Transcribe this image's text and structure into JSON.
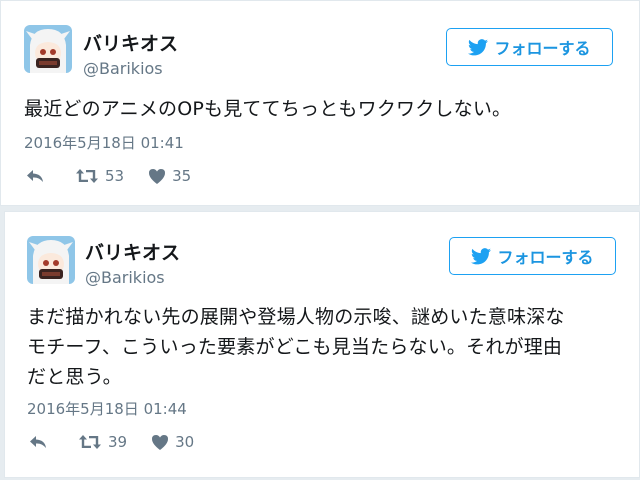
{
  "tweets": [
    {
      "author_name": "バリキオス",
      "author_handle": "@Barikios",
      "follow_label": "フォローする",
      "text": "最近どのアニメのOPも見ててちっともワクワクしない。",
      "timestamp": "2016年5月18日 01:41",
      "retweets": "53",
      "likes": "35"
    },
    {
      "author_name": "バリキオス",
      "author_handle": "@Barikios",
      "follow_label": "フォローする",
      "text_lines": [
        "まだ描かれない先の展開や登場人物の示唆、謎めいた意味深な",
        "モチーフ、こういった要素がどこも見当たらない。それが理由",
        "だと思う。"
      ],
      "timestamp": "2016年5月18日 01:44",
      "retweets": "39",
      "likes": "30"
    }
  ],
  "colors": {
    "accent": "#1da1f2",
    "follow_text": "#1b95e0",
    "secondary_text": "#657786",
    "background": "#e6ecf0"
  },
  "icons": [
    "twitter-bird-icon",
    "reply-icon",
    "retweet-icon",
    "heart-icon"
  ]
}
